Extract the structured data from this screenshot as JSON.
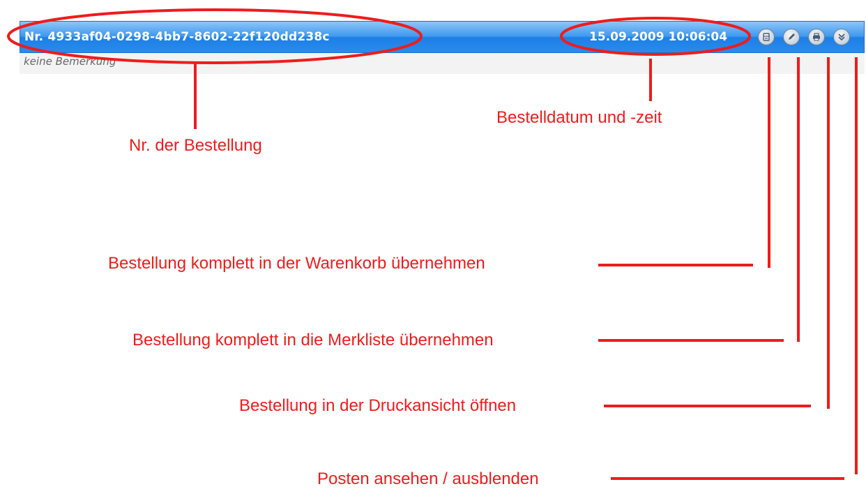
{
  "order": {
    "number": "Nr. 4933af04-0298-4bb7-8602-22f120dd238c",
    "datetime": "15.09.2009 10:06:04",
    "remark": "keine Bemerkung"
  },
  "actions": [
    {
      "icon": "cart-icon"
    },
    {
      "icon": "pencil-icon"
    },
    {
      "icon": "printer-icon"
    },
    {
      "icon": "chevron-down-icon"
    }
  ],
  "annotations": {
    "order_number": "Nr. der Bestellung",
    "order_datetime": "Bestelldatum und -zeit",
    "add_to_cart": "Bestellung komplett in der Warenkorb übernehmen",
    "add_to_wishlist": "Bestellung komplett in die Merkliste übernehmen",
    "print_view": "Bestellung in der Druckansicht öffnen",
    "toggle_items": "Posten ansehen / ausblenden"
  },
  "colors": {
    "header_blue": "#2a8bec",
    "annotation_red": "#ee1c1c"
  }
}
